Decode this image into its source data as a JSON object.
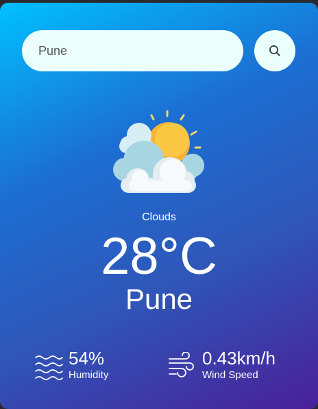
{
  "search": {
    "value": "Pune",
    "icon": "search-icon"
  },
  "weather": {
    "icon": "sun-behind-clouds-icon",
    "condition": "Clouds",
    "temperature": "28°C",
    "city": "Pune"
  },
  "details": {
    "humidity": {
      "icon": "humidity-waves-icon",
      "value": "54%",
      "label": "Humidity"
    },
    "wind": {
      "icon": "wind-icon",
      "value": "0.43km/h",
      "label": "Wind Speed"
    }
  },
  "colors": {
    "gradient_start": "#00c0ff",
    "gradient_end": "#4a2098",
    "input_background": "#ebfffc"
  }
}
